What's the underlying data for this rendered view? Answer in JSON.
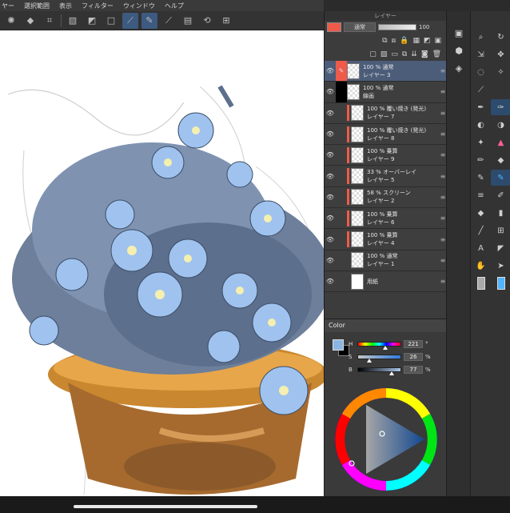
{
  "menubar": {
    "items": [
      "ヤー",
      "選択範囲",
      "表示",
      "フィルター",
      "ウィンドウ",
      "ヘルプ"
    ]
  },
  "canvas": {
    "label": "Canvas artwork"
  },
  "layer_panel": {
    "title": "レイヤー",
    "blend_mode": "通常",
    "opacity": "100",
    "layers": [
      {
        "line1": "100 % 通常",
        "line2": "レイヤー 3",
        "selected": true,
        "mark_color": "#ef5a4a"
      },
      {
        "line1": "100 % 通常",
        "line2": "線画",
        "selected": false,
        "mark_color": "#000000"
      },
      {
        "line1": "100 % 覆い焼き (発光)",
        "line2": "レイヤー 7",
        "selected": false,
        "mark_color": "#ef5a4a"
      },
      {
        "line1": "100 % 覆い焼き (発光)",
        "line2": "レイヤー 8",
        "selected": false,
        "mark_color": "#ef5a4a"
      },
      {
        "line1": "100 % 乗算",
        "line2": "レイヤー 9",
        "selected": false,
        "mark_color": "#ef5a4a"
      },
      {
        "line1": "33 % オーバーレイ",
        "line2": "レイヤー 5",
        "selected": false,
        "mark_color": "#ef5a4a"
      },
      {
        "line1": "58 % スクリーン",
        "line2": "レイヤー 2",
        "selected": false,
        "mark_color": "#ef5a4a"
      },
      {
        "line1": "100 % 乗算",
        "line2": "レイヤー 6",
        "selected": false,
        "mark_color": "#ef5a4a"
      },
      {
        "line1": "100 % 乗算",
        "line2": "レイヤー 4",
        "selected": false,
        "mark_color": "#ef5a4a"
      },
      {
        "line1": "100 % 通常",
        "line2": "レイヤー 1",
        "selected": false,
        "mark_color": ""
      },
      {
        "line1": "",
        "line2": "用紙",
        "selected": false,
        "mark_color": ""
      }
    ]
  },
  "color_panel": {
    "title": "Color",
    "h_label": "H",
    "h_value": "221",
    "h_unit": "°",
    "h_fraction": 0.614,
    "s_label": "S",
    "s_value": "26",
    "s_unit": "%",
    "s_fraction": 0.26,
    "b_label": "B",
    "b_value": "77",
    "b_unit": "%",
    "b_fraction": 0.77,
    "main_color": "#8bb6e3",
    "sub_color": "#000000"
  },
  "colors": {
    "layer_mark_red": "#ef5a4a",
    "selected_row": "#4c5d7a",
    "accent_blue": "#4fb4ff"
  },
  "icons": {
    "command_bar": [
      "sparkle-icon",
      "fill-icon",
      "transform-icon",
      "transparency-icon",
      "mask-icon",
      "ruler-icon",
      "pen-curve-icon",
      "pen-stroke-icon",
      "pen-line-icon",
      "ruler-doc-icon",
      "rotate-icon",
      "grid-icon"
    ],
    "tool_palette": [
      "search-icon",
      "lasso-rotate-icon",
      "select-move-icon",
      "move-icon",
      "lasso-icon",
      "magic-wand-icon",
      "eyedropper-icon",
      "pen-icon",
      "pen-active-icon",
      "drop-icon",
      "drop-blur-icon",
      "sparkle-icon",
      "cake-icon",
      "pencil-icon",
      "eraser-icon",
      "brush-icon",
      "brush-active-icon",
      "lines-icon",
      "lasso-fill-icon",
      "fill-bucket-icon",
      "gradient-icon",
      "line-icon",
      "frame-icon",
      "text-icon",
      "triangle-icon",
      "hand-icon",
      "arrow-icon",
      "gray-swatch-icon",
      "blue-swatch-icon",
      "transparent-swatch-icon"
    ]
  }
}
